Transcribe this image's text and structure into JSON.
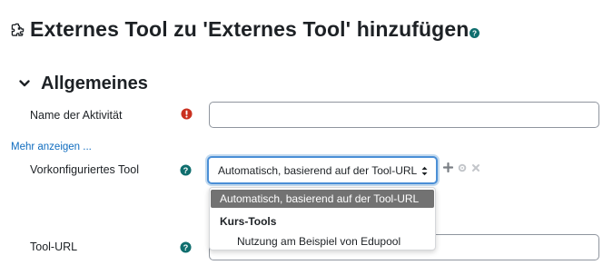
{
  "header": {
    "title": "Externes Tool zu 'Externes Tool' hinzufügen",
    "icon": "puzzle-icon",
    "help_icon": "help-icon"
  },
  "section": {
    "title": "Allgemeines",
    "icon": "chevron-down-icon"
  },
  "fields": {
    "activity_name": {
      "label": "Name der Aktivität",
      "value": "",
      "status_icon": "required-icon"
    },
    "more_link": "Mehr anzeigen ...",
    "preconfigured_tool": {
      "label": "Vorkonfiguriertes Tool",
      "selected": "Automatisch, basierend auf der Tool-URL",
      "help_icon": "help-icon",
      "side_icons": [
        "plus-icon",
        "gear-icon",
        "close-icon"
      ]
    },
    "tool_url": {
      "label": "Tool-URL",
      "value": "",
      "help_icon": "help-icon"
    }
  },
  "dropdown": {
    "selected_option": "Automatisch, basierend auf der Tool-URL",
    "group_label": "Kurs-Tools",
    "options": [
      "Nutzung am Beispiel von Edupool"
    ]
  },
  "colors": {
    "link": "#0f6cbf",
    "required": "#ca3120",
    "help": "#0f6e6e",
    "focus": "#4b8fd6",
    "selected_bg": "#727272"
  }
}
